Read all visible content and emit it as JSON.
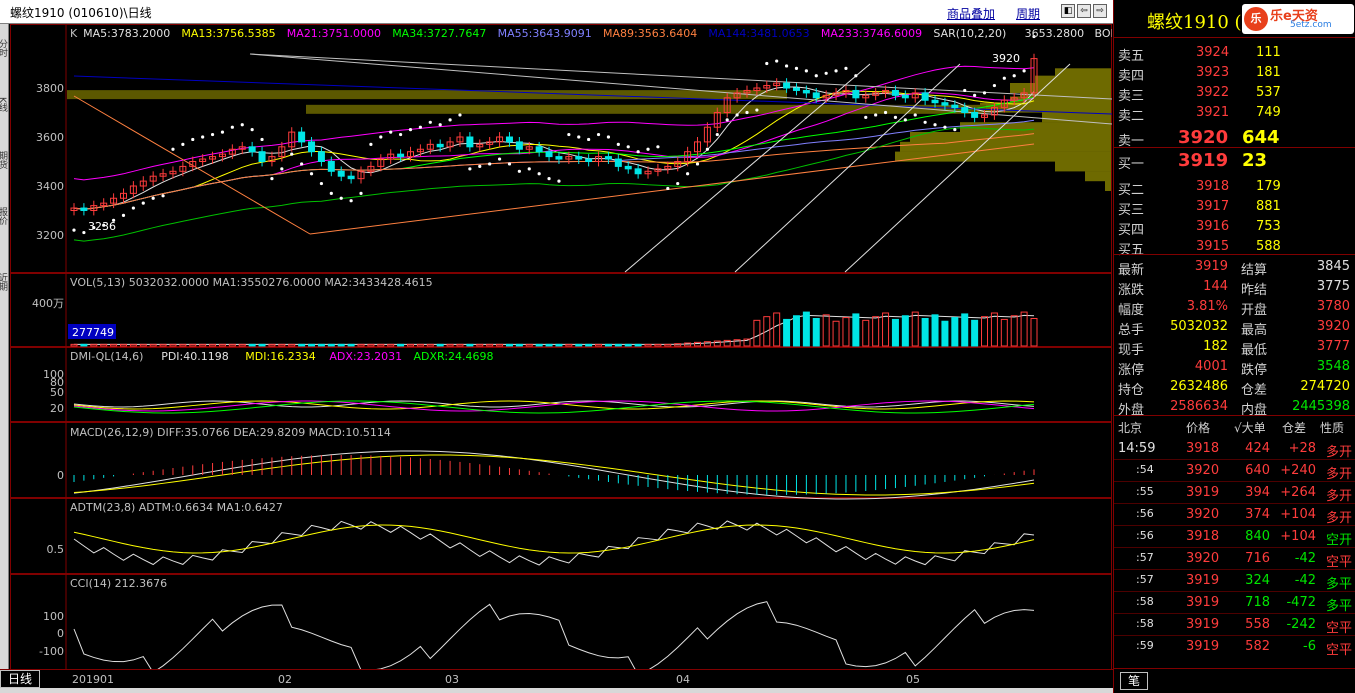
{
  "window": {
    "title": "螺纹1910 (010610)\\日线",
    "links": [
      "商品叠加",
      "周期"
    ],
    "nav_buttons": [
      "◧",
      "⇦",
      "⇨",
      "▫"
    ]
  },
  "left_tabs": [
    "分时",
    "K线",
    "期货",
    "报价",
    "近期"
  ],
  "kline": {
    "indicator_line": [
      {
        "text": "K",
        "color": "#c0c0c0"
      },
      {
        "text": "MA5:3783.2000",
        "color": "#e0e0e0"
      },
      {
        "text": "MA13:3756.5385",
        "color": "#ffff00"
      },
      {
        "text": "MA21:3751.0000",
        "color": "#ff00ff"
      },
      {
        "text": "MA34:3727.7647",
        "color": "#00ff00"
      },
      {
        "text": "MA55:3643.9091",
        "color": "#8080ff"
      },
      {
        "text": "MA89:3563.6404",
        "color": "#ff8040"
      },
      {
        "text": "MA144:3481.0653",
        "color": "#0000c0"
      },
      {
        "text": "MA233:3746.6009",
        "color": "#ff00ff"
      },
      {
        "text": "SAR(10,2,20)",
        "color": "#e0e0e0"
      },
      {
        "text": "3653.2800",
        "color": "#e0e0e0"
      },
      {
        "text": "BOLL(26,2)",
        "color": "#e0e0e0"
      },
      {
        "text": "M",
        "color": "#e0e0e0"
      }
    ],
    "y_ticks": [
      "3800",
      "3600",
      "3400",
      "3200"
    ],
    "high_label": "3920",
    "low_label": "3236"
  },
  "vol": {
    "title": "VOL(5,13) 5032032.0000  MA1:3550276.0000  MA2:3433428.4615",
    "y_tick": "400万",
    "cursor_label": "277749"
  },
  "dmi": {
    "parts": [
      {
        "text": "DMI-QL(14,6)",
        "color": "#c0c0c0"
      },
      {
        "text": "PDI:40.1198",
        "color": "#e0e0e0"
      },
      {
        "text": "MDI:16.2334",
        "color": "#ffff00"
      },
      {
        "text": "ADX:23.2031",
        "color": "#ff00ff"
      },
      {
        "text": "ADXR:24.4698",
        "color": "#00ff00"
      }
    ],
    "y_ticks": [
      "100",
      "80",
      "50",
      "20"
    ]
  },
  "macd": {
    "title": "MACD(26,12,9)  DIFF:35.0766  DEA:29.8209  MACD:10.5114",
    "y_tick": "0"
  },
  "adtm": {
    "title": "ADTM(23,8)  ADTM:0.6634  MA1:0.6427",
    "y_tick": "0.5"
  },
  "cci": {
    "title": "CCI(14)  212.3676",
    "y_ticks": [
      "100",
      "0",
      "-100"
    ]
  },
  "x_axis": {
    "period_label": "日线",
    "labels": [
      "201901",
      "02",
      "03",
      "04",
      "05"
    ]
  },
  "quote": {
    "name": "螺纹1910 (r",
    "logo": {
      "circle": "乐",
      "text": "乐e天资",
      "sub": "5etz.com"
    },
    "asks": [
      {
        "label": "卖五",
        "price": "3924",
        "vol": "111"
      },
      {
        "label": "卖四",
        "price": "3923",
        "vol": "181"
      },
      {
        "label": "卖三",
        "price": "3922",
        "vol": "537"
      },
      {
        "label": "卖二",
        "price": "3921",
        "vol": "749"
      },
      {
        "label": "卖一",
        "price": "3920",
        "vol": "644"
      }
    ],
    "bids": [
      {
        "label": "买一",
        "price": "3919",
        "vol": "23"
      },
      {
        "label": "买二",
        "price": "3918",
        "vol": "179"
      },
      {
        "label": "买三",
        "price": "3917",
        "vol": "881"
      },
      {
        "label": "买四",
        "price": "3916",
        "vol": "753"
      },
      {
        "label": "买五",
        "price": "3915",
        "vol": "588"
      }
    ],
    "stats": [
      {
        "l1": "最新",
        "v1": "3919",
        "c1": "red",
        "l2": "结算",
        "v2": "3845",
        "c2": "wht"
      },
      {
        "l1": "涨跌",
        "v1": "144",
        "c1": "red",
        "l2": "昨结",
        "v2": "3775",
        "c2": "wht"
      },
      {
        "l1": "幅度",
        "v1": "3.81%",
        "c1": "red",
        "l2": "开盘",
        "v2": "3780",
        "c2": "red"
      },
      {
        "l1": "总手",
        "v1": "5032032",
        "c1": "yel",
        "l2": "最高",
        "v2": "3920",
        "c2": "red"
      },
      {
        "l1": "现手",
        "v1": "182",
        "c1": "yel",
        "l2": "最低",
        "v2": "3777",
        "c2": "red"
      },
      {
        "l1": "涨停",
        "v1": "4001",
        "c1": "red",
        "l2": "跌停",
        "v2": "3548",
        "c2": "grn"
      },
      {
        "l1": "持仓",
        "v1": "2632486",
        "c1": "yel",
        "l2": "仓差",
        "v2": "274720",
        "c2": "yel"
      },
      {
        "l1": "外盘",
        "v1": "2586634",
        "c1": "red",
        "l2": "内盘",
        "v2": "2445398",
        "c2": "grn"
      }
    ],
    "ticks_header": [
      "北京",
      "价格",
      "√大单",
      "仓差",
      "性质"
    ],
    "ticks": [
      {
        "time": "14:59",
        "price": "3918",
        "vol": "424",
        "vc": "red",
        "oi": "+28",
        "oc": "red",
        "nature": "多开",
        "nc": "red"
      },
      {
        "time": ":54",
        "price": "3920",
        "vol": "640",
        "vc": "red",
        "oi": "+240",
        "oc": "red",
        "nature": "多开",
        "nc": "red"
      },
      {
        "time": ":55",
        "price": "3919",
        "vol": "394",
        "vc": "red",
        "oi": "+264",
        "oc": "red",
        "nature": "多开",
        "nc": "red"
      },
      {
        "time": ":56",
        "price": "3920",
        "vol": "374",
        "vc": "red",
        "oi": "+104",
        "oc": "red",
        "nature": "多开",
        "nc": "red"
      },
      {
        "time": ":56",
        "price": "3918",
        "vol": "840",
        "vc": "grn",
        "oi": "+104",
        "oc": "red",
        "nature": "空开",
        "nc": "grn"
      },
      {
        "time": ":57",
        "price": "3920",
        "vol": "716",
        "vc": "red",
        "oi": "-42",
        "oc": "grn",
        "nature": "空平",
        "nc": "red"
      },
      {
        "time": ":57",
        "price": "3919",
        "vol": "324",
        "vc": "grn",
        "oi": "-42",
        "oc": "grn",
        "nature": "多平",
        "nc": "grn"
      },
      {
        "time": ":58",
        "price": "3919",
        "vol": "718",
        "vc": "grn",
        "oi": "-472",
        "oc": "grn",
        "nature": "多平",
        "nc": "grn"
      },
      {
        "time": ":58",
        "price": "3919",
        "vol": "558",
        "vc": "red",
        "oi": "-242",
        "oc": "grn",
        "nature": "空平",
        "nc": "red"
      },
      {
        "time": ":59",
        "price": "3919",
        "vol": "582",
        "vc": "red",
        "oi": "-6",
        "oc": "grn",
        "nature": "空平",
        "nc": "red"
      }
    ],
    "bottom_tab": "笔"
  }
}
